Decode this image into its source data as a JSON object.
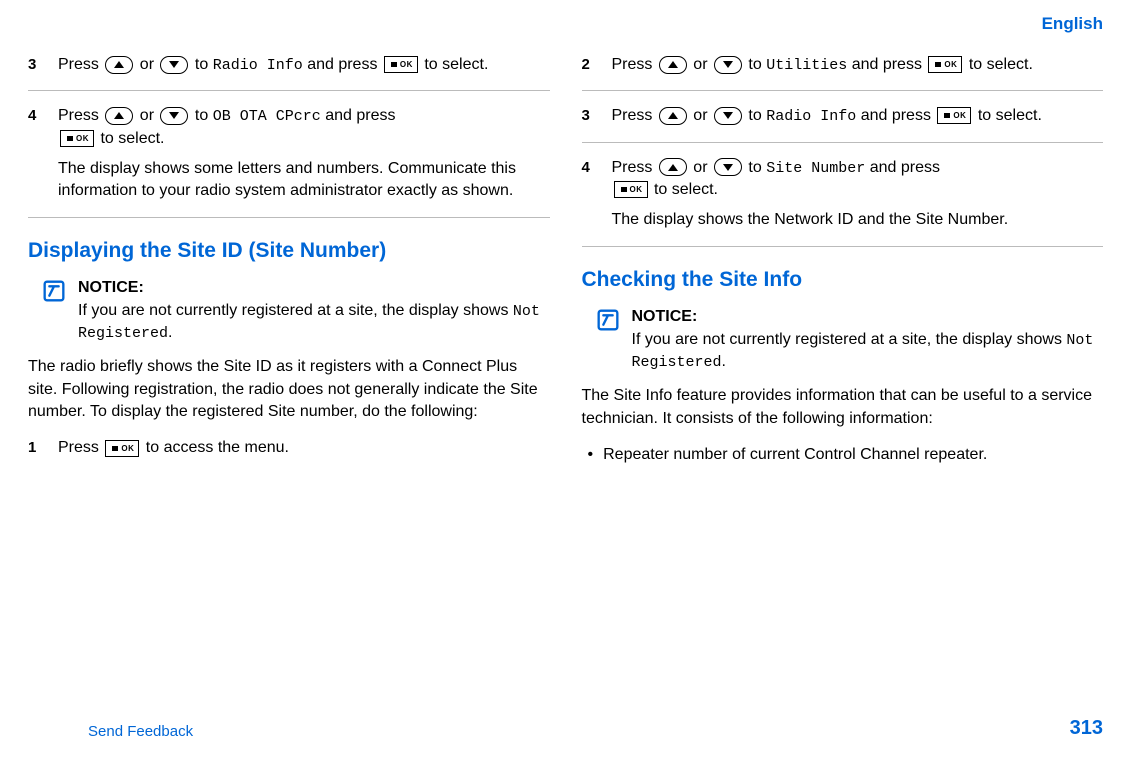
{
  "header": {
    "lang": "English"
  },
  "col1": {
    "step3": {
      "num": "3",
      "prefix": "Press ",
      "or": " or ",
      "to": " to ",
      "menu1": "Radio Info",
      "andpress": " and press ",
      "toselect": "to select."
    },
    "step4": {
      "num": "4",
      "prefix": "Press ",
      "or": " or ",
      "to": " to ",
      "menu1": "OB OTA CPcrc",
      "andpress": " and press",
      "toselect": " to select.",
      "result": "The display shows some letters and numbers. Communicate this information to your radio system administrator exactly as shown."
    },
    "heading1": "Displaying the Site ID (Site Number)",
    "notice1": {
      "title": "NOTICE:",
      "text1": "If you are not currently registered at a site, the display shows ",
      "mono": "Not Registered",
      "text2": "."
    },
    "para1": "The radio briefly shows the Site ID as it registers with a Connect Plus site. Following registration, the radio does not generally indicate the Site number. To display the registered Site number, do the following:",
    "b_step1": {
      "num": "1",
      "prefix": "Press ",
      "suffix": " to access the menu."
    }
  },
  "col2": {
    "step2": {
      "num": "2",
      "prefix": "Press ",
      "or": " or ",
      "to": " to ",
      "menu1": "Utilities",
      "andpress": " and press ",
      "toselect": "to select."
    },
    "step3": {
      "num": "3",
      "prefix": "Press ",
      "or": " or ",
      "to": " to ",
      "menu1": "Radio Info",
      "andpress": " and press ",
      "toselect": "to select."
    },
    "step4": {
      "num": "4",
      "prefix": "Press ",
      "or": " or ",
      "to": " to ",
      "menu1": "Site Number",
      "andpress": " and press",
      "toselect": " to select.",
      "result": "The display shows the Network ID and the Site Number."
    },
    "heading1": "Checking the Site Info",
    "notice1": {
      "title": "NOTICE:",
      "text1": "If you are not currently registered at a site, the display shows ",
      "mono": "Not Registered",
      "text2": "."
    },
    "para1": "The Site Info feature provides information that can be useful to a service technician. It consists of the following information:",
    "bullet1": "Repeater number of current Control Channel repeater."
  },
  "footer": {
    "feedback": "Send Feedback",
    "pagenum": "313"
  },
  "icons": {
    "ok_label": "OK"
  }
}
